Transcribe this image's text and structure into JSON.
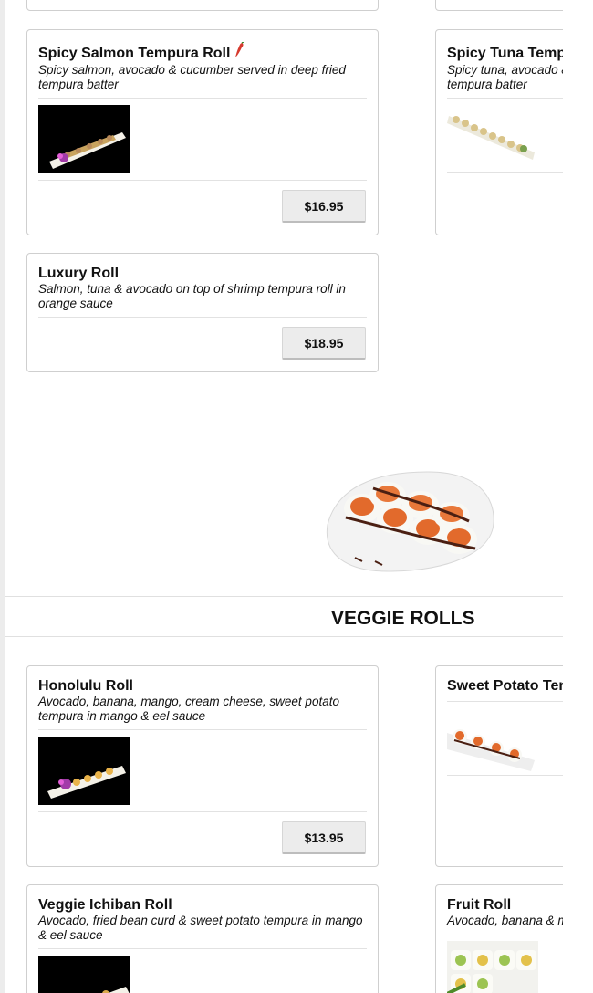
{
  "rolls": {
    "spicy_salmon": {
      "title": "Spicy Salmon Tempura Roll",
      "desc": "Spicy salmon, avocado & cucumber served in deep fried tempura batter",
      "price": "$16.95",
      "spicy_icon": "chili-pepper-icon"
    },
    "spicy_tuna": {
      "title": "Spicy Tuna Tempura Roll",
      "desc": "Spicy tuna, avocado & cucumber served in deep fried tempura batter"
    },
    "luxury": {
      "title": "Luxury Roll",
      "desc": "Salmon, tuna & avocado on top of shrimp tempura roll in orange sauce",
      "price": "$18.95"
    }
  },
  "veggie_section": {
    "title": "VEGGIE ROLLS",
    "items": {
      "honolulu": {
        "title": "Honolulu Roll",
        "desc": "Avocado, banana, mango, cream cheese, sweet potato tempura in mango & eel sauce",
        "price": "$13.95"
      },
      "sweet_potato": {
        "title": "Sweet Potato Tempura Roll"
      },
      "veggie_ichiban": {
        "title": "Veggie Ichiban Roll",
        "desc": "Avocado, fried bean curd & sweet potato tempura in mango & eel sauce"
      },
      "fruit": {
        "title": "Fruit Roll",
        "desc": "Avocado, banana & mango"
      }
    }
  },
  "colors": {
    "card_border": "#cfcfcf",
    "button_bg": "#ececec",
    "pepper_red": "#d63a2e"
  }
}
